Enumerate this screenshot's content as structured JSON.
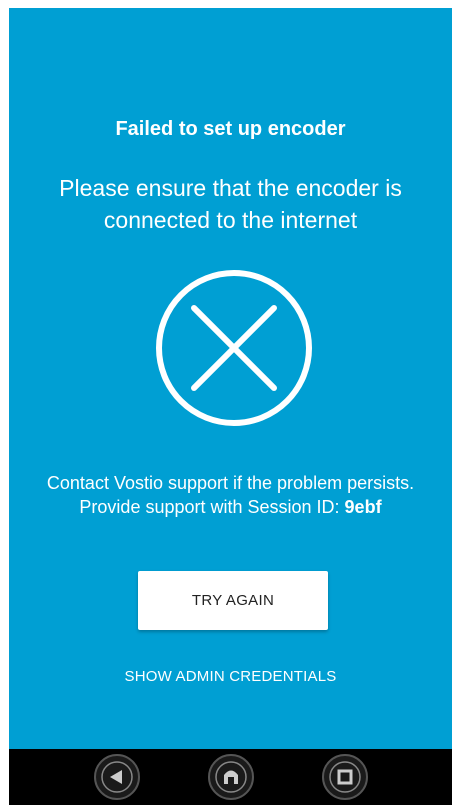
{
  "error": {
    "title": "Failed to set up encoder",
    "subtitle": "Please ensure that the encoder is connected to the internet",
    "icon": "close-circle-icon",
    "support_text": "Contact Vostio support if the problem persists. Provide support with Session ID: ",
    "session_id": "9ebf"
  },
  "actions": {
    "try_again_label": "TRY AGAIN",
    "admin_credentials_label": "SHOW ADMIN CREDENTIALS"
  },
  "navbar": {
    "buttons": [
      "back-icon",
      "home-icon",
      "recents-icon"
    ]
  },
  "colors": {
    "background": "#009fd3",
    "foreground": "#ffffff",
    "button_bg": "#ffffff",
    "button_text": "#222222",
    "navbar": "#000000"
  }
}
